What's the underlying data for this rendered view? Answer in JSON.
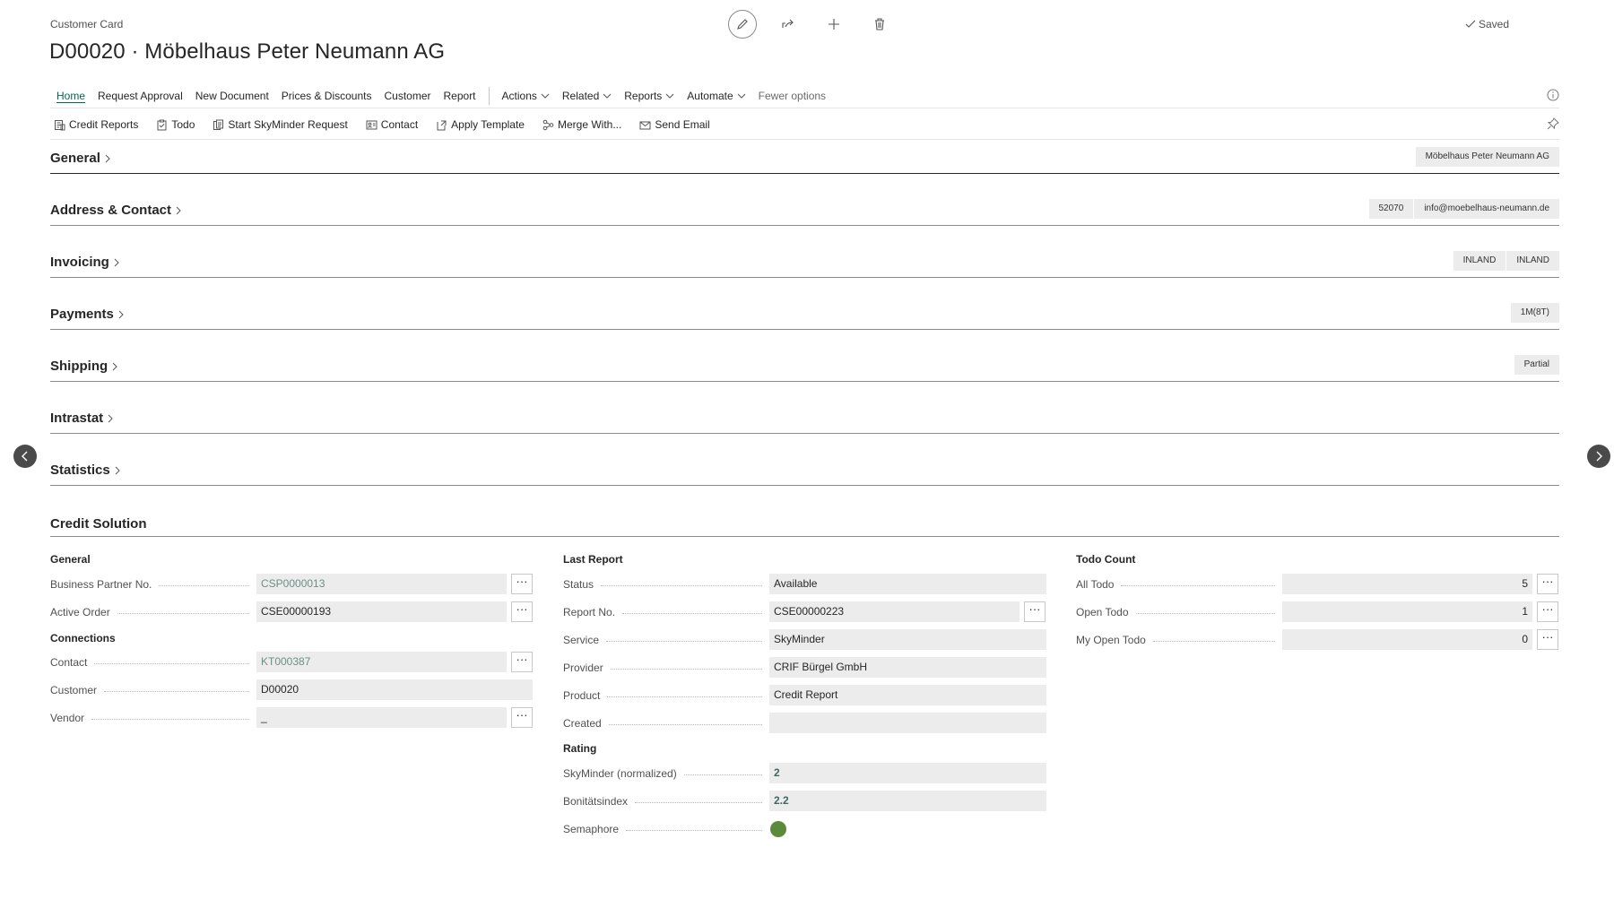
{
  "page": {
    "caption": "Customer Card",
    "title": "D00020 · Möbelhaus Peter Neumann AG",
    "status": "Saved"
  },
  "menu": {
    "items": [
      "Home",
      "Request Approval",
      "New Document",
      "Prices & Discounts",
      "Customer",
      "Report"
    ],
    "dropdowns": [
      "Actions",
      "Related",
      "Reports",
      "Automate"
    ],
    "fewer": "Fewer options"
  },
  "actions": [
    "Credit Reports",
    "Todo",
    "Start SkyMinder Request",
    "Contact",
    "Apply Template",
    "Merge With...",
    "Send Email"
  ],
  "fasttabs": {
    "general": {
      "title": "General",
      "chips": [
        "Möbelhaus Peter Neumann AG"
      ]
    },
    "address": {
      "title": "Address & Contact",
      "chips": [
        "52070",
        "info@moebelhaus-neumann.de"
      ]
    },
    "invoicing": {
      "title": "Invoicing",
      "chips": [
        "INLAND",
        "INLAND"
      ]
    },
    "payments": {
      "title": "Payments",
      "chips": [
        "1M(8T)"
      ]
    },
    "shipping": {
      "title": "Shipping",
      "chips": [
        "Partial"
      ]
    },
    "intrastat": {
      "title": "Intrastat"
    },
    "statistics": {
      "title": "Statistics"
    }
  },
  "credit": {
    "title": "Credit Solution",
    "col1": {
      "general_label": "General",
      "bp_label": "Business Partner No.",
      "bp_value": "CSP0000013",
      "order_label": "Active Order",
      "order_value": "CSE00000193",
      "connections_label": "Connections",
      "contact_label": "Contact",
      "contact_value": "KT000387",
      "customer_label": "Customer",
      "customer_value": "D00020",
      "vendor_label": "Vendor",
      "vendor_value": "_"
    },
    "col2": {
      "last_report_label": "Last Report",
      "status_label": "Status",
      "status_value": "Available",
      "report_label": "Report No.",
      "report_value": "CSE00000223",
      "service_label": "Service",
      "service_value": "SkyMinder",
      "provider_label": "Provider",
      "provider_value": "CRIF Bürgel GmbH",
      "product_label": "Product",
      "product_value": "Credit Report",
      "created_label": "Created",
      "created_value": "",
      "rating_label": "Rating",
      "sky_label": "SkyMinder (normalized)",
      "sky_value": "2",
      "boni_label": "Bonitätsindex",
      "boni_value": "2.2",
      "sema_label": "Semaphore"
    },
    "col3": {
      "todo_label": "Todo Count",
      "all_label": "All Todo",
      "all_value": "5",
      "open_label": "Open Todo",
      "open_value": "1",
      "my_label": "My Open Todo",
      "my_value": "0"
    },
    "dots": "···"
  },
  "colors": {
    "accent": "#00664f",
    "semaphore": "#5b8a3c",
    "nav_arrow": "#4a4a4a"
  }
}
